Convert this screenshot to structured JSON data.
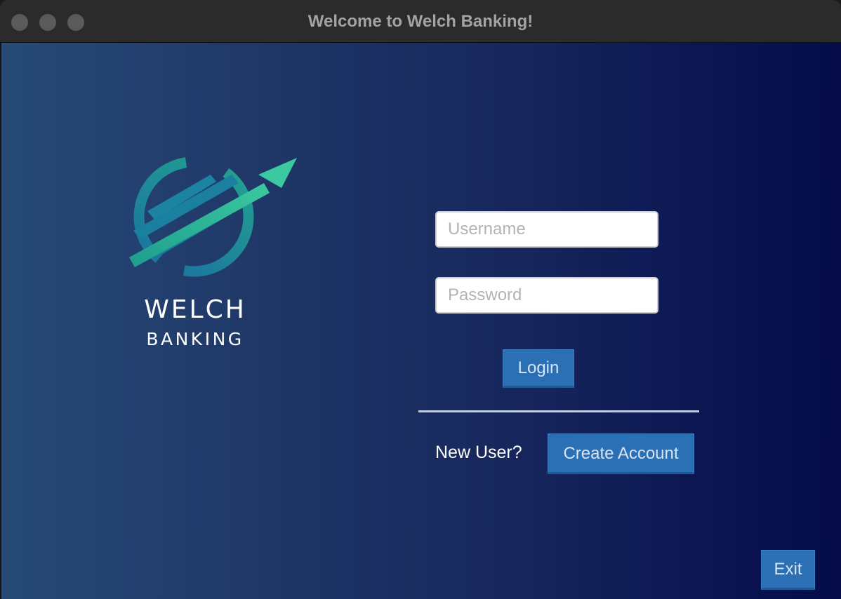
{
  "window": {
    "title": "Welcome to Welch Banking!"
  },
  "brand": {
    "line1": "WELCH",
    "line2": "BANKING",
    "logo_icon": "globe-arrow-logo",
    "colors": {
      "teal": "#1f8fa0",
      "green": "#22b596"
    }
  },
  "login_form": {
    "username_placeholder": "Username",
    "username_value": "",
    "password_placeholder": "Password",
    "password_value": "",
    "login_label": "Login"
  },
  "signup": {
    "prompt": "New User?",
    "create_label": "Create Account"
  },
  "footer": {
    "exit_label": "Exit"
  },
  "colors": {
    "button_bg": "#2b6fb5",
    "gradient_left": "#274a77",
    "gradient_right": "#050c4a"
  }
}
